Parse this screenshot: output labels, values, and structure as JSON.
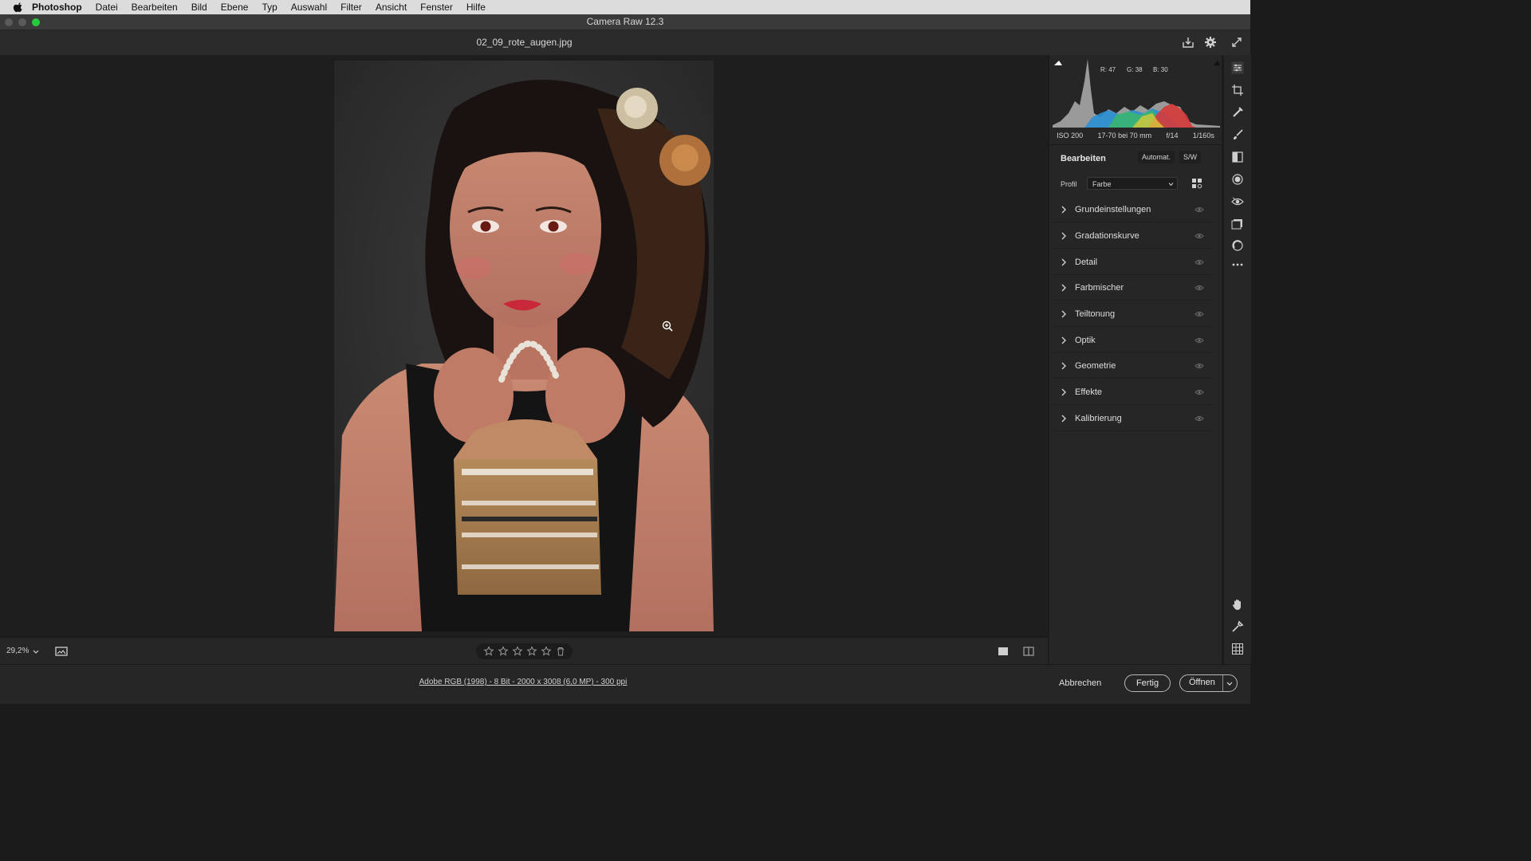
{
  "menubar": {
    "app_name": "Photoshop",
    "items": [
      "Datei",
      "Bearbeiten",
      "Bild",
      "Ebene",
      "Typ",
      "Auswahl",
      "Filter",
      "Ansicht",
      "Fenster",
      "Hilfe"
    ]
  },
  "window": {
    "title": "Camera Raw 12.3"
  },
  "document": {
    "filename": "02_09_rote_augen.jpg"
  },
  "histogram": {
    "r_label": "R:",
    "r_value": "47",
    "g_label": "G:",
    "g_value": "38",
    "b_label": "B:",
    "b_value": "30"
  },
  "exif": {
    "iso": "ISO 200",
    "lens": "17-70 bei 70 mm",
    "aperture": "f/14",
    "shutter": "1/160s"
  },
  "edit": {
    "title": "Bearbeiten",
    "auto_label": "Automat.",
    "bw_label": "S/W",
    "profile_label": "Profil",
    "profile_value": "Farbe",
    "sections": [
      "Grundeinstellungen",
      "Gradationskurve",
      "Detail",
      "Farbmischer",
      "Teiltonung",
      "Optik",
      "Geometrie",
      "Effekte",
      "Kalibrierung"
    ]
  },
  "bottom": {
    "zoom": "29,2%"
  },
  "footer": {
    "info": "Adobe RGB (1998) - 8 Bit - 2000 x 3008 (6,0 MP) - 300 ppi",
    "cancel": "Abbrechen",
    "done": "Fertig",
    "open": "Öffnen"
  },
  "colors": {
    "accent_green": "#27c93f",
    "panel_bg": "#262626",
    "canvas_bg": "#1e1e1e"
  },
  "icons": {
    "topbar": [
      "save-icon",
      "gear-icon",
      "fullscreen-icon"
    ],
    "tools": [
      "edit-sliders-icon",
      "crop-icon",
      "heal-icon",
      "brush-icon",
      "gradient-icon",
      "radial-filter-icon",
      "redeye-icon",
      "presets-icon",
      "snapshots-icon",
      "more-icon",
      "hand-icon",
      "color-sampler-icon",
      "grid-icon"
    ]
  }
}
